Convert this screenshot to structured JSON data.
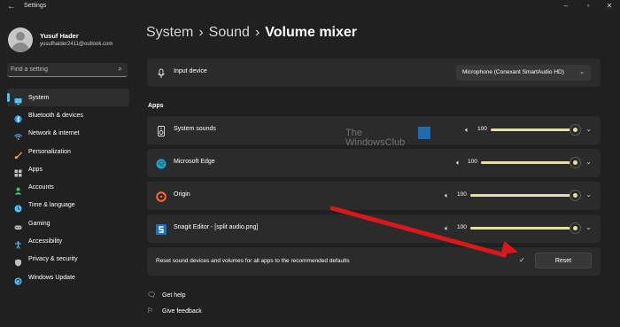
{
  "window": {
    "title": "Settings"
  },
  "user": {
    "name": "Yusuf Hader",
    "email": "yusufhaider2411@outlook.com"
  },
  "search": {
    "placeholder": "Find a setting"
  },
  "nav": {
    "items": [
      {
        "label": "System",
        "icon": "monitor-icon",
        "color": "#4cc2ff"
      },
      {
        "label": "Bluetooth & devices",
        "icon": "bluetooth-icon",
        "color": "#1e90ff"
      },
      {
        "label": "Network & internet",
        "icon": "wifi-icon",
        "color": "#6cc0ff"
      },
      {
        "label": "Personalization",
        "icon": "brush-icon",
        "color": "#e8a060"
      },
      {
        "label": "Apps",
        "icon": "apps-icon",
        "color": "#c0c0c0"
      },
      {
        "label": "Accounts",
        "icon": "person-icon",
        "color": "#3cc47c"
      },
      {
        "label": "Time & language",
        "icon": "globe-clock-icon",
        "color": "#4cc2ff"
      },
      {
        "label": "Gaming",
        "icon": "controller-icon",
        "color": "#c0c0c0"
      },
      {
        "label": "Accessibility",
        "icon": "accessibility-icon",
        "color": "#4cc2ff"
      },
      {
        "label": "Privacy & security",
        "icon": "shield-icon",
        "color": "#c0c0c0"
      },
      {
        "label": "Windows Update",
        "icon": "update-icon",
        "color": "#4cc2ff"
      }
    ],
    "active_index": 0
  },
  "breadcrumb": {
    "item1": "System",
    "item2": "Sound",
    "current": "Volume mixer",
    "separator": "›"
  },
  "input_device": {
    "label": "Input device",
    "selected": "Microphone (Conexant SmartAudio HD)"
  },
  "apps_section": {
    "title": "Apps"
  },
  "apps": [
    {
      "name": "System sounds",
      "volume": "100",
      "level": 1.0,
      "icon": "speaker-icon"
    },
    {
      "name": "Microsoft Edge",
      "volume": "100",
      "level": 1.0,
      "icon": "edge-icon"
    },
    {
      "name": "Origin",
      "volume": "100",
      "level": 1.0,
      "icon": "origin-icon"
    },
    {
      "name": "Snagit Editor - [split audio.png]",
      "volume": "100",
      "level": 1.0,
      "icon": "snagit-icon"
    }
  ],
  "reset": {
    "label": "Reset sound devices and volumes for all apps to the recommended defaults",
    "button": "Reset"
  },
  "links": {
    "help": "Get help",
    "feedback": "Give feedback"
  },
  "watermark": {
    "line1": "The",
    "line2": "WindowsClub"
  },
  "colors": {
    "accent": "#4cc2ff",
    "slider": "#e5e0a0",
    "annotation_arrow": "#d8181b"
  }
}
